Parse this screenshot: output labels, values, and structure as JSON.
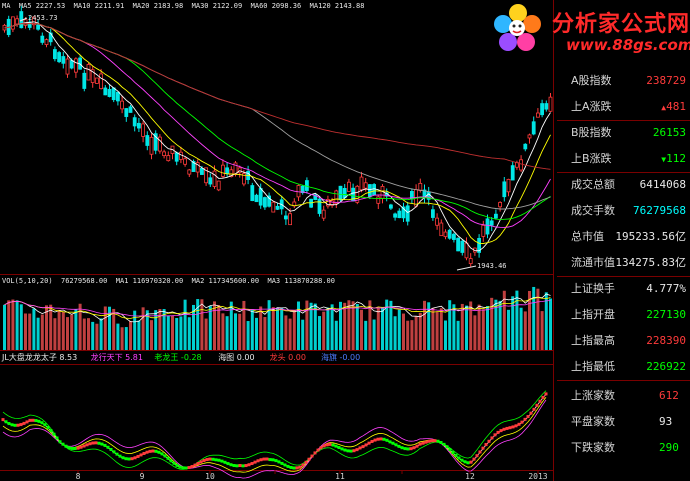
{
  "colors": {
    "up": "#ff3b3b",
    "down": "#00e6e6",
    "grid": "#7a0000",
    "green": "#00ff00",
    "yellow": "#ffff00",
    "white": "#e8e8e8",
    "magenta": "#ff40ff",
    "text": "#d6d6d6"
  },
  "logo": {
    "title": "分析家公式网",
    "url": "www.88gs.com",
    "flower_icon": "flower-logo-icon"
  },
  "main_chart": {
    "ma_header": "MA  MA5 2227.53  MA10 2211.91  MA20 2183.98  MA30 2122.09  MA60 2098.36  MA120 2143.88",
    "high_label": "2453.73",
    "low_label": "1943.46"
  },
  "volume": {
    "header": "VOL(5,10,20)  76279568.00  MA1 116970320.00  MA2 117345600.00  MA3 113870288.00"
  },
  "indicator": {
    "items": [
      {
        "text": "JL大盘龙龙太子 8.53",
        "color": "#e8e8e8"
      },
      {
        "text": "龙行天下 5.81",
        "color": "#ff40ff"
      },
      {
        "text": "老龙王 -0.28",
        "color": "#00ff00"
      },
      {
        "text": "海图 0.00",
        "color": "#e8e8e8"
      },
      {
        "text": "龙头 0.00",
        "color": "#ff3b3b"
      },
      {
        "text": "海旗 -0.00",
        "color": "#4d7bff"
      }
    ]
  },
  "x_axis": {
    "labels": [
      "8",
      "9",
      "10",
      "11",
      "12",
      "2013"
    ]
  },
  "panel": {
    "rows": [
      {
        "key": "A股指数",
        "value": "238729",
        "color": "#ff3b3b",
        "arrow": ""
      },
      {
        "key": "上A涨跌",
        "value": "481",
        "color": "#ff3b3b",
        "arrow": "▲"
      },
      {
        "key": "B股指数",
        "value": "26153",
        "color": "#00ff00",
        "arrow": ""
      },
      {
        "key": "上B涨跌",
        "value": "112",
        "color": "#00ff00",
        "arrow": "▼"
      },
      {
        "key": "成交总额",
        "value": "6414068",
        "color": "#e8e8e8",
        "arrow": ""
      },
      {
        "key": "成交手数",
        "value": "76279568",
        "color": "#00ffff",
        "arrow": ""
      },
      {
        "key": "总市值",
        "value": "195233.56亿",
        "color": "#e8e8e8",
        "arrow": ""
      },
      {
        "key": "流通市值",
        "value": "134275.83亿",
        "color": "#e8e8e8",
        "arrow": ""
      },
      {
        "key": "上证换手",
        "value": "4.777%",
        "color": "#e8e8e8",
        "arrow": ""
      },
      {
        "key": "上指开盘",
        "value": "227130",
        "color": "#00ff00",
        "arrow": ""
      },
      {
        "key": "上指最高",
        "value": "228390",
        "color": "#ff3b3b",
        "arrow": ""
      },
      {
        "key": "上指最低",
        "value": "226922",
        "color": "#00ff00",
        "arrow": ""
      },
      {
        "key": "上涨家数",
        "value": "612",
        "color": "#ff3b3b",
        "arrow": ""
      },
      {
        "key": "平盘家数",
        "value": "93",
        "color": "#e8e8e8",
        "arrow": ""
      },
      {
        "key": "下跌家数",
        "value": "290",
        "color": "#00ff00",
        "arrow": ""
      }
    ]
  }
}
